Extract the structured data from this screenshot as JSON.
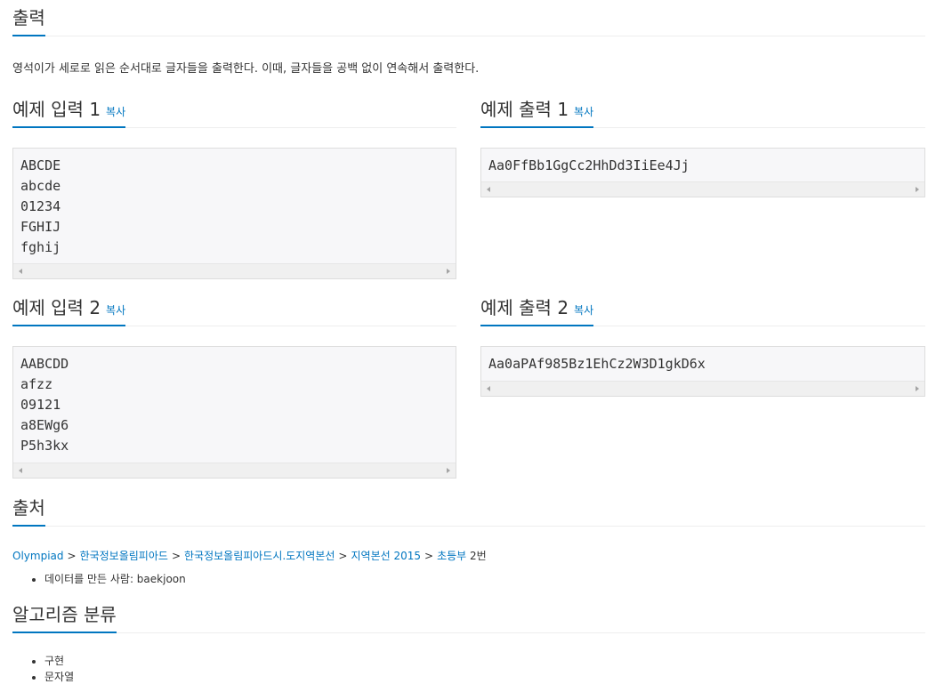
{
  "output_section": {
    "title": "출력",
    "text": "영석이가 세로로 읽은 순서대로 글자들을 출력한다. 이때, 글자들을 공백 없이 연속해서 출력한다."
  },
  "copy_label": "복사",
  "examples": [
    {
      "input_title": "예제 입력 1",
      "input": "ABCDE\nabcde\n01234\nFGHIJ\nfghij",
      "output_title": "예제 출력 1",
      "output": "Aa0FfBb1GgCc2HhDd3IiEe4Jj"
    },
    {
      "input_title": "예제 입력 2",
      "input": "AABCDD\nafzz\n09121\na8EWg6\nP5h3kx",
      "output_title": "예제 출력 2",
      "output": "Aa0aPAf985Bz1EhCz2W3D1gkD6x"
    }
  ],
  "source_section": {
    "title": "출처",
    "breadcrumb": [
      "Olympiad",
      "한국정보올림피아드",
      "한국정보올림피아드시.도지역본선",
      "지역본선 2015",
      "초등부"
    ],
    "separator": ">",
    "suffix": "2번",
    "credit": "데이터를 만든 사람: baekjoon"
  },
  "algorithm_section": {
    "title": "알고리즘 분류",
    "tags": [
      "구현",
      "문자열"
    ]
  }
}
